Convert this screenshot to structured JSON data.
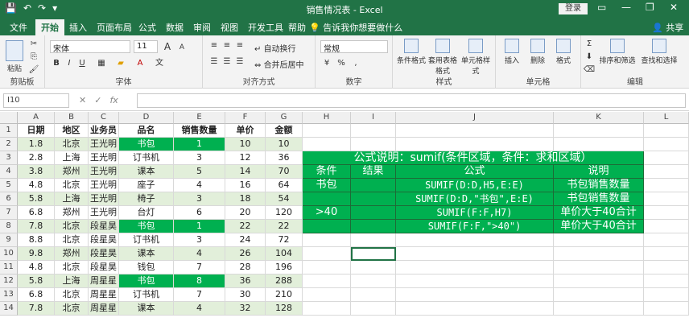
{
  "window": {
    "title": "销售情况表 - Excel",
    "login_label": "登录",
    "min": "—",
    "restore": "❐",
    "close": "✕",
    "ribbon_opts": "▭"
  },
  "qat": {
    "save": "💾",
    "undo": "↶",
    "redo": "↷",
    "customize": "▾"
  },
  "tabs": [
    "文件",
    "开始",
    "插入",
    "页面布局",
    "公式",
    "数据",
    "审阅",
    "视图",
    "开发工具",
    "帮助"
  ],
  "active_tab": "开始",
  "search": {
    "icon": "lightbulb-icon",
    "text": "告诉我你想要做什么"
  },
  "share_label": "共享",
  "ribbon": {
    "clipboard": {
      "label": "剪贴板",
      "paste": "粘贴"
    },
    "font": {
      "label": "字体",
      "font_name": "宋体",
      "font_size": "11",
      "bold": "B",
      "italic": "I",
      "underline": "U",
      "grow": "A",
      "shrink": "A",
      "phonetic": "文"
    },
    "align": {
      "label": "对齐方式",
      "wrap": "自动换行",
      "merge": "合并后居中"
    },
    "number": {
      "label": "数字",
      "format": "常规",
      "percent": "%",
      "comma": ",",
      "currency": "¥"
    },
    "styles": {
      "label": "样式",
      "cond": "条件格式",
      "table": "套用表格格式",
      "cell": "单元格样式"
    },
    "cells": {
      "label": "单元格",
      "insert": "插入",
      "delete": "删除",
      "format": "格式"
    },
    "edit": {
      "label": "编辑",
      "sort": "排序和筛选",
      "find": "查找和选择",
      "sum": "Σ"
    }
  },
  "formula_bar": {
    "name_box": "I10",
    "cancel": "✕",
    "enter": "✓",
    "fx": "fx",
    "formula": ""
  },
  "columns": [
    "A",
    "B",
    "C",
    "D",
    "E",
    "F",
    "G",
    "H",
    "I",
    "J",
    "K",
    "L"
  ],
  "rows": [
    "1",
    "2",
    "3",
    "4",
    "5",
    "6",
    "7",
    "8",
    "9",
    "10",
    "11",
    "12",
    "13",
    "14"
  ],
  "table": {
    "headers": [
      "日期",
      "地区",
      "业务员",
      "品名",
      "销售数量",
      "单价",
      "金额"
    ],
    "data": [
      [
        "1.8",
        "北京",
        "王光明",
        "书包",
        "1",
        "10",
        "10"
      ],
      [
        "2.8",
        "上海",
        "王光明",
        "订书机",
        "3",
        "12",
        "36"
      ],
      [
        "3.8",
        "郑州",
        "王光明",
        "课本",
        "5",
        "14",
        "70"
      ],
      [
        "4.8",
        "北京",
        "王光明",
        "座子",
        "4",
        "16",
        "64"
      ],
      [
        "5.8",
        "上海",
        "王光明",
        "椅子",
        "3",
        "18",
        "54"
      ],
      [
        "6.8",
        "郑州",
        "王光明",
        "台灯",
        "6",
        "20",
        "120"
      ],
      [
        "7.8",
        "北京",
        "段星昊",
        "书包",
        "1",
        "22",
        "22"
      ],
      [
        "8.8",
        "北京",
        "段星昊",
        "订书机",
        "3",
        "24",
        "72"
      ],
      [
        "9.8",
        "郑州",
        "段星昊",
        "课本",
        "4",
        "26",
        "104"
      ],
      [
        "4.8",
        "北京",
        "段星昊",
        "钱包",
        "7",
        "28",
        "196"
      ],
      [
        "5.8",
        "上海",
        "周星星",
        "书包",
        "8",
        "36",
        "288"
      ],
      [
        "6.8",
        "北京",
        "周星星",
        "订书机",
        "7",
        "30",
        "210"
      ],
      [
        "7.8",
        "北京",
        "周星星",
        "课本",
        "4",
        "32",
        "128"
      ]
    ]
  },
  "explain": {
    "title": "公式说明：sumif(条件区域，条件：求和区域）",
    "headers": [
      "条件",
      "结果",
      "公式",
      "说明"
    ],
    "rows": [
      [
        "书包",
        "",
        "SUMIF(D:D,H5,E:E)",
        "书包销售数量"
      ],
      [
        "",
        "",
        "SUMIF(D:D,\"书包\",E:E)",
        "书包销售数量"
      ],
      [
        ">40",
        "",
        "SUMIF(F:F,H7)",
        "单价大于40合计"
      ],
      [
        "",
        "",
        "SUMIF(F:F,\">40\")",
        "单价大于40合计"
      ]
    ]
  },
  "colors": {
    "excel_green": "#217346",
    "highlight_green": "#00b050",
    "band_green": "#e2efda"
  }
}
